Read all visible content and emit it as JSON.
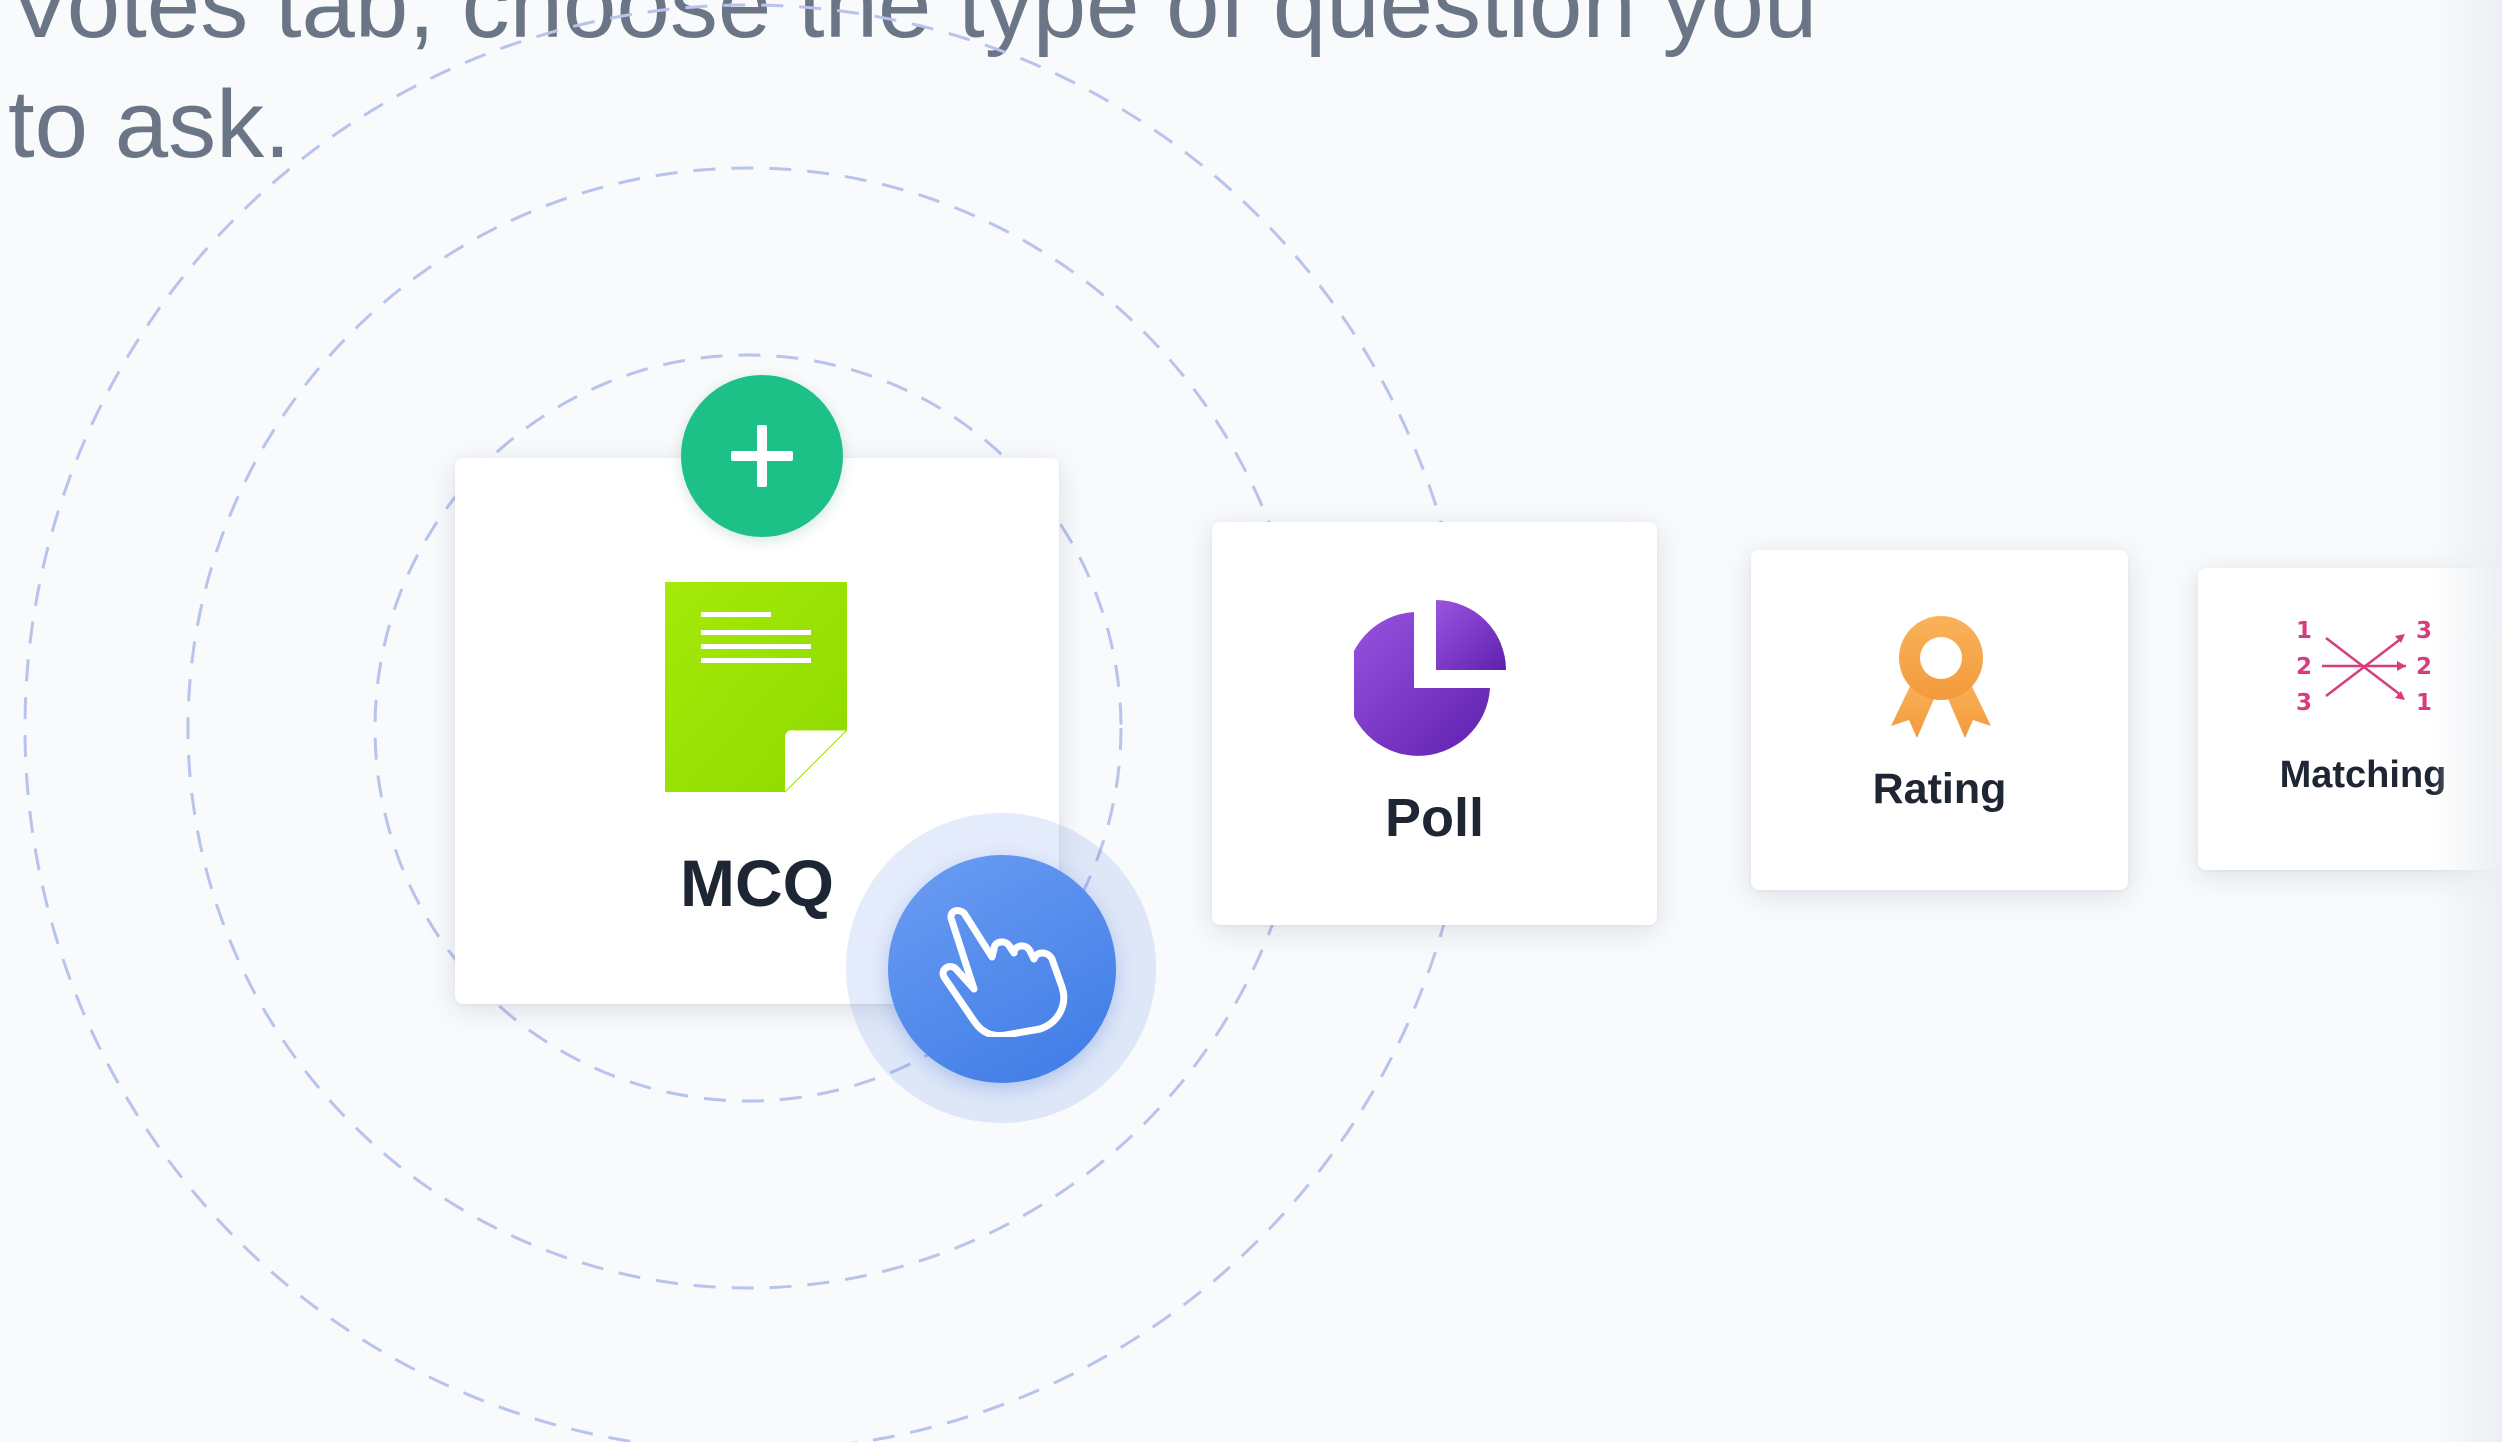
{
  "intro": {
    "line1": "Votes tab, choose the type of question you",
    "line2": "to ask."
  },
  "add_button": {
    "icon": "plus-icon"
  },
  "cursor": {
    "icon": "pointer-hand-icon"
  },
  "question_types": {
    "mcq": {
      "label": "MCQ",
      "icon": "document-icon"
    },
    "poll": {
      "label": "Poll",
      "icon": "pie-chart-icon"
    },
    "rating": {
      "label": "Rating",
      "icon": "award-ribbon-icon"
    },
    "matching": {
      "label": "Matching",
      "icon": "matching-arrows-icon",
      "left_numbers": [
        "1",
        "2",
        "3"
      ],
      "right_numbers": [
        "3",
        "2",
        "1"
      ]
    }
  },
  "colors": {
    "background": "#f8fafc",
    "text_muted": "#6a7585",
    "card_label": "#1e2533",
    "add_green": "#1dc187",
    "cursor_blue": "#4a86ea",
    "doc_green": "#9be000",
    "poll_purple": "#7a35c9",
    "rating_orange": "#f7a54a",
    "matching_pink": "#d63c7e",
    "ring_dash": "#b9c3ec"
  }
}
